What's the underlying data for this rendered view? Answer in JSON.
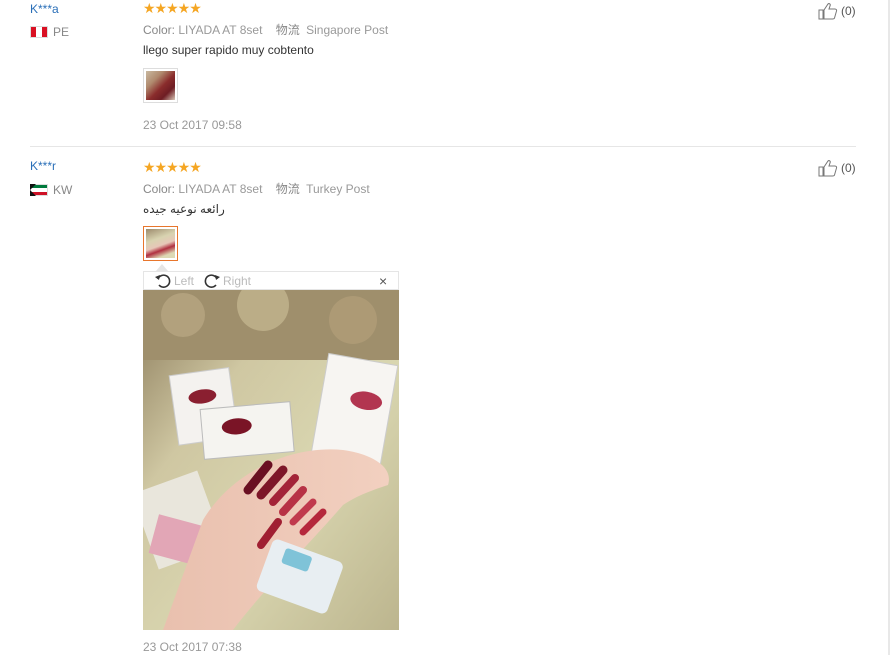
{
  "colors": {
    "link_blue": "#2a6fb8",
    "star_orange": "#f5a623",
    "thumb_active_border": "#e8762c"
  },
  "reviews": [
    {
      "user": "K***a",
      "country": "PE",
      "flag_icon": "peru-flag-icon",
      "rating_stars": 5,
      "stars": "★★★★★",
      "color_label": "Color:",
      "color_value": "LIYADA AT 8set",
      "shipping_label": "物流",
      "shipping_value": "Singapore Post",
      "text": "llego super rapido muy cobtento",
      "date": "23 Oct 2017 09:58",
      "helpful": "(0)"
    },
    {
      "user": "K***r",
      "country": "KW",
      "flag_icon": "kuwait-flag-icon",
      "rating_stars": 5,
      "stars": "★★★★★",
      "color_label": "Color:",
      "color_value": "LIYADA AT 8set",
      "shipping_label": "物流",
      "shipping_value": "Turkey Post",
      "text": "رائعه نوعيه جيده",
      "date": "23 Oct 2017 07:38",
      "helpful": "(0)"
    }
  ],
  "viewer": {
    "rotate_left_label": "Left",
    "rotate_right_label": "Right",
    "close_glyph": "×"
  }
}
